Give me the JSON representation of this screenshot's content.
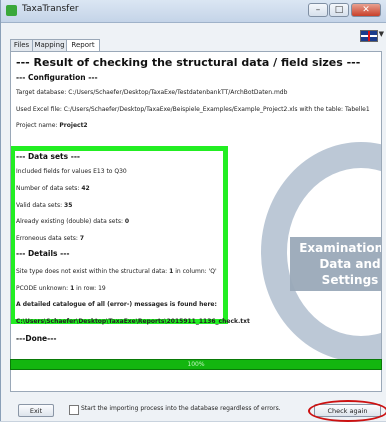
{
  "window": {
    "title": "TaxaTransfer"
  },
  "tabs": [
    {
      "label": "Files"
    },
    {
      "label": "Mapping"
    },
    {
      "label": "Report"
    }
  ],
  "report": {
    "header": "--- Result of checking the structural data / field sizes ---",
    "configuration_title": "--- Configuration ---",
    "target_database": "Target database: C:/Users/Schaefer/Desktop/TaxaExe/TestdatenbankTT/ArchBotDaten.mdb",
    "used_excel_file": "Used Excel file: C:/Users/Schaefer/Desktop/TaxaExe/Beispiele_Examples/Example_Project2.xls with the table: Tabelle1",
    "project_name_label": "Project name:",
    "project_name_value": "Project2",
    "datasets_title": "--- Data sets ---",
    "included_fields": "Included fields for values E13 to Q30",
    "number_label": "Number of data sets:",
    "number_value": "42",
    "valid_label": "Valid data sets:",
    "valid_value": "35",
    "double_label": "Already existing (double) data sets:",
    "double_value": "0",
    "erroneous_label": "Erroneous data sets:",
    "erroneous_value": "7",
    "details_title": "--- Details ---",
    "site_type_text": "Site type does not exist within the structural data:",
    "site_type_value": "1",
    "site_type_column": "in column: 'Q'",
    "pcode_label": "PCODE unknown:",
    "pcode_value": "1",
    "pcode_row": "in row: 19",
    "catalogue_text": "A detailed catalogue of all (error-) messages is found here:",
    "catalogue_path": "C:\\Users\\Schaefer\\Desktop\\TaxaExe\\Reports\\2015911_1136_check.txt",
    "done": "---Done---"
  },
  "overlay": {
    "note": "Examination of Data and Settings"
  },
  "progress": {
    "label": "100%",
    "value": 1.0
  },
  "footer": {
    "exit_label": "Exit",
    "checkbox_label": "Start the importing process into the database regardless of errors.",
    "check_again_label": "Check again"
  },
  "colors": {
    "highlight": "#22ee22",
    "progress": "#13b60f",
    "ring": "#cc1111"
  }
}
